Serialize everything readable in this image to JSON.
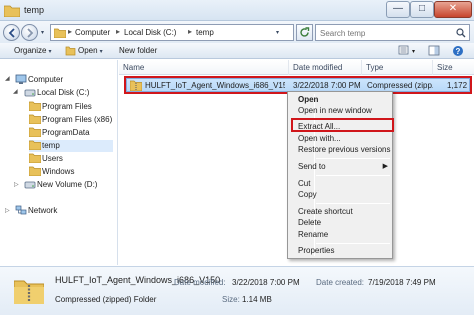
{
  "window": {
    "title": "temp",
    "min_glyph": "—",
    "max_glyph": "□",
    "close_glyph": "✕"
  },
  "address": {
    "crumbs": [
      "Computer",
      "Local Disk (C:)",
      "temp"
    ],
    "separator": "▸",
    "search_placeholder": "Search temp"
  },
  "toolbar": {
    "organize": "Organize",
    "open": "Open",
    "new_folder": "New folder",
    "dropdown_glyph": "▾"
  },
  "nav": {
    "computer": "Computer",
    "local_disk": "Local Disk (C:)",
    "folders": [
      "Program Files",
      "Program Files (x86)",
      "ProgramData",
      "temp",
      "Users",
      "Windows"
    ],
    "new_volume": "New Volume (D:)",
    "network": "Network",
    "selected": "temp"
  },
  "columns": {
    "name": "Name",
    "date_modified": "Date modified",
    "type": "Type",
    "size": "Size"
  },
  "file": {
    "name": "HULFT_IoT_Agent_Windows_i686_V150",
    "date_modified": "3/22/2018 7:00 PM",
    "type": "Compressed (zipp...",
    "size": "1,172"
  },
  "context_menu": {
    "items": [
      {
        "label": "Open",
        "bold": true
      },
      {
        "label": "Open in new window"
      },
      {
        "label": "Extract All..."
      },
      {
        "label": "Open with..."
      },
      {
        "label": "Restore previous versions"
      },
      {
        "label": "Send to",
        "submenu": true
      },
      {
        "label": "Cut"
      },
      {
        "label": "Copy"
      },
      {
        "label": "Create shortcut"
      },
      {
        "label": "Delete"
      },
      {
        "label": "Rename"
      },
      {
        "label": "Properties"
      }
    ],
    "submenu_arrow": "▶",
    "highlighted": "Extract All..."
  },
  "details": {
    "name": "HULFT_IoT_Agent_Windows_i686_V150",
    "type": "Compressed (zipped) Folder",
    "date_modified_label": "Date modified:",
    "date_modified": "3/22/2018 7:00 PM",
    "size_label": "Size:",
    "size": "1.14 MB",
    "date_created_label": "Date created:",
    "date_created": "7/19/2018 7:49 PM"
  },
  "colors": {
    "highlight_border": "#d0161b",
    "selection": "#cce5fc",
    "folder": "#e8c15a"
  }
}
